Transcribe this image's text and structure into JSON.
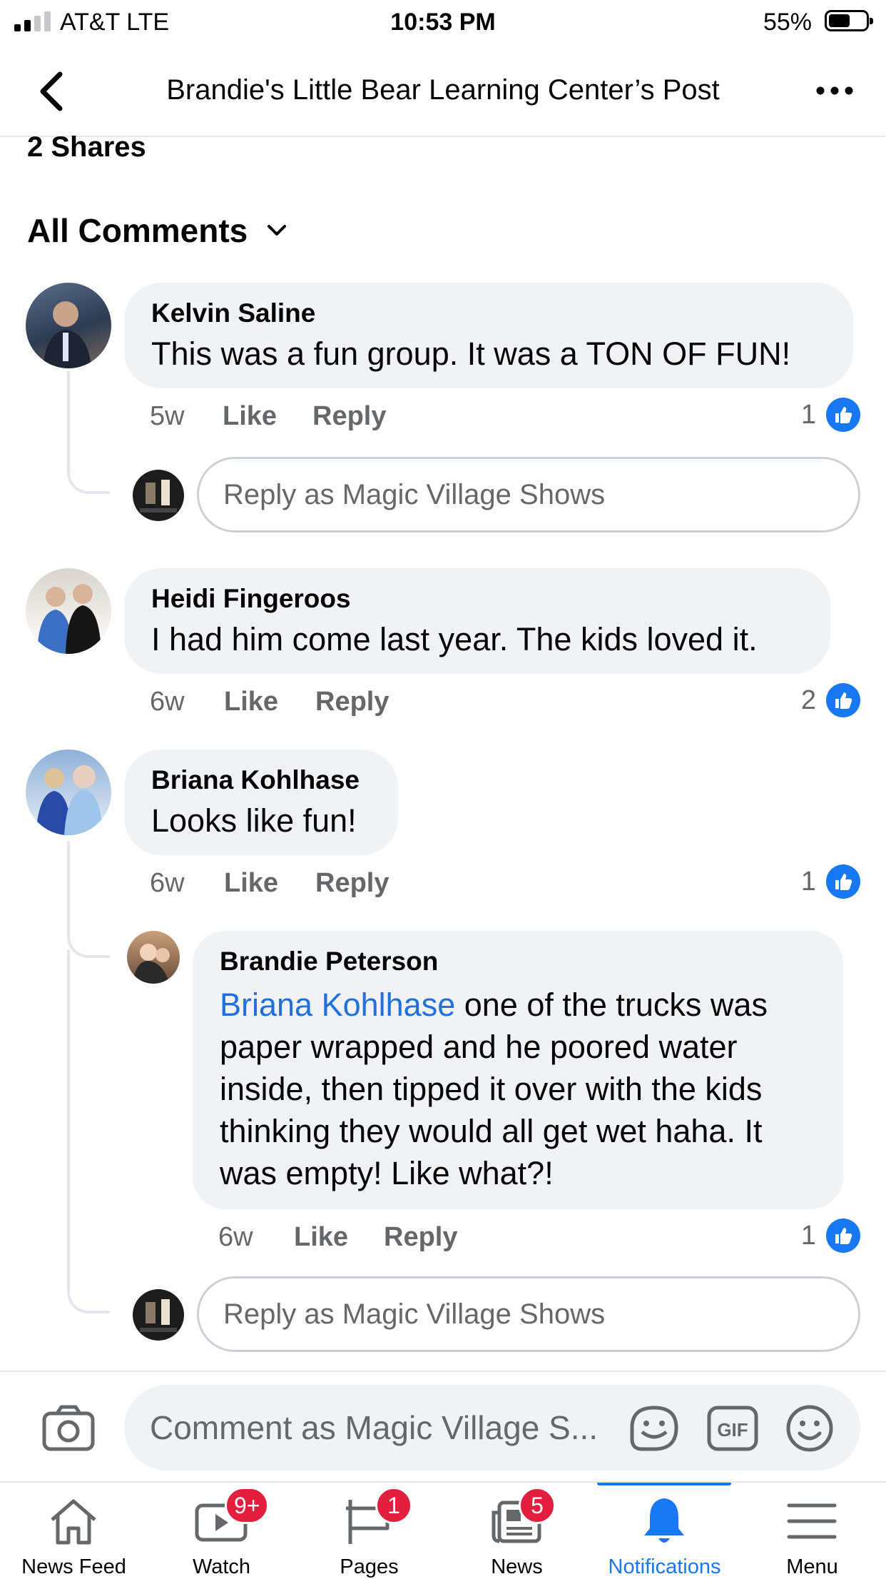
{
  "status_bar": {
    "carrier": "AT&T  LTE",
    "time": "10:53 PM",
    "battery": "55%",
    "battery_level": 0.55
  },
  "header": {
    "title": "Brandie's Little Bear Learning Center’s Post"
  },
  "shares": "2 Shares",
  "comments_filter": "All Comments",
  "comments": [
    {
      "author": "Kelvin Saline",
      "text": "This was a fun group. It was a TON OF FUN!",
      "time": "5w",
      "like": "Like",
      "reply": "Reply",
      "likes": "1"
    },
    {
      "author": "Heidi Fingeroos",
      "text": "I had him come last year. The kids loved it.",
      "time": "6w",
      "like": "Like",
      "reply": "Reply",
      "likes": "2"
    },
    {
      "author": "Briana Kohlhase",
      "text": "Looks like fun!",
      "time": "6w",
      "like": "Like",
      "reply": "Reply",
      "likes": "1"
    }
  ],
  "reply": {
    "author": "Brandie Peterson",
    "mention": "Briana Kohlhase",
    "text_line1": " one of the trucks was",
    "text_line2": "paper wrapped and he poored water",
    "text_line3": "inside, then tipped it over with the kids",
    "text_line4": "thinking they would all get wet haha. It",
    "text_line5": "was empty! Like what?!",
    "time": "6w",
    "like": "Like",
    "reply": "Reply",
    "likes": "1"
  },
  "reply_placeholder": "Reply as Magic Village Shows",
  "composer": {
    "placeholder": "Comment as Magic Village S...",
    "gif_label": "GIF"
  },
  "tabs": [
    {
      "label": "News Feed",
      "icon": "home-icon"
    },
    {
      "label": "Watch",
      "icon": "watch-icon",
      "badge": "9+"
    },
    {
      "label": "Pages",
      "icon": "flag-icon",
      "badge": "1"
    },
    {
      "label": "News",
      "icon": "news-icon",
      "badge": "5"
    },
    {
      "label": "Notifications",
      "icon": "bell-icon"
    },
    {
      "label": "Menu",
      "icon": "menu-icon"
    }
  ],
  "colors": {
    "accent": "#1877f2",
    "badge": "#e41e3f",
    "bubble": "#f0f2f5",
    "mention": "#216fdb"
  }
}
